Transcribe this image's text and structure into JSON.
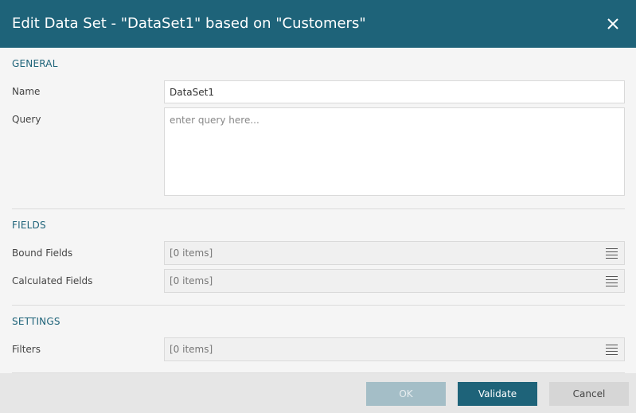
{
  "dialog": {
    "title": "Edit Data Set - \"DataSet1\" based on \"Customers\"",
    "close_icon": "close-icon"
  },
  "general": {
    "section_title": "GENERAL",
    "name_label": "Name",
    "name_value": "DataSet1",
    "query_label": "Query",
    "query_placeholder": "enter query here..."
  },
  "fields": {
    "section_title": "FIELDS",
    "bound_label": "Bound Fields",
    "bound_value": "[0 items]",
    "calculated_label": "Calculated Fields",
    "calculated_value": "[0 items]"
  },
  "settings": {
    "section_title": "SETTINGS",
    "filters_label": "Filters",
    "filters_value": "[0 items]"
  },
  "footer": {
    "ok_label": "OK",
    "validate_label": "Validate",
    "cancel_label": "Cancel"
  },
  "colors": {
    "accent": "#1e6379",
    "ok_disabled": "#a4bec7",
    "cancel": "#d6d6d6"
  }
}
